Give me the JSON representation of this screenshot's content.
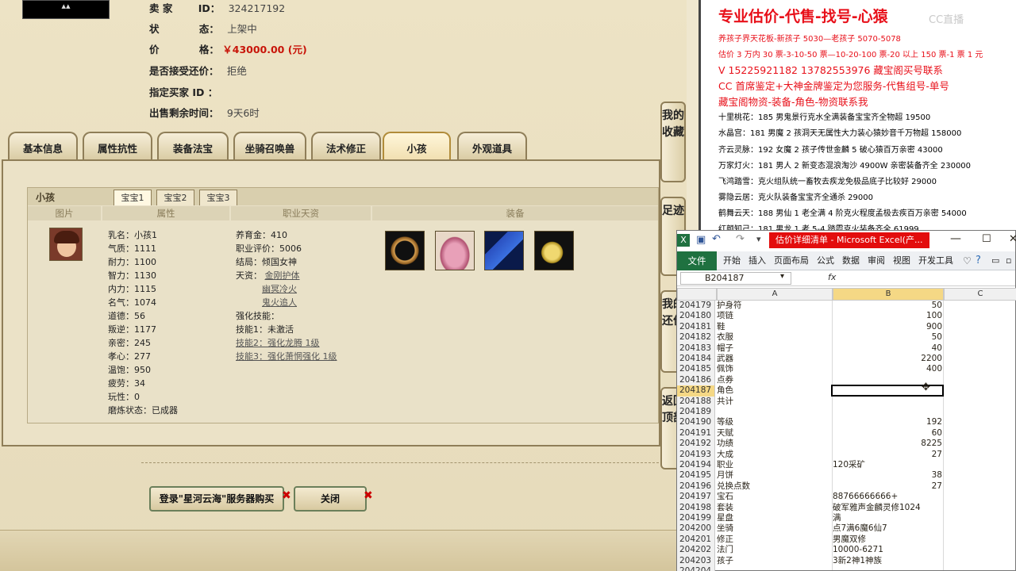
{
  "game": {
    "thumb_icon": "item-thumb",
    "seller_label": "卖 家",
    "seller_id_label": "ID：",
    "seller_id": "324217192",
    "status_label": "状",
    "status_label2": "态：",
    "status_value": "上架中",
    "price_label": "价",
    "price_label2": "格：",
    "price_value": "￥43000.00 (元)",
    "counter_offer_label": "是否接受还价：",
    "counter_offer_value": "拒绝",
    "buyer_label": "指定买家 ID ：",
    "time_label": "出售剩余时间：",
    "time_value": "9天6时",
    "tabs": [
      "基本信息",
      "属性抗性",
      "装备法宝",
      "坐骑召唤兽",
      "法术修正",
      "小孩",
      "外观道具"
    ],
    "panel_title": "小孩",
    "baby_tabs": [
      "宝宝1",
      "宝宝2",
      "宝宝3"
    ],
    "columns": [
      "图片",
      "属性",
      "职业天资",
      "装备"
    ],
    "attributes": [
      "乳名：小孩1",
      "气质：1111",
      "耐力：1100",
      "智力：1130",
      "内力：1115",
      "名气：1074",
      "道德：56",
      "叛逆：1177",
      "亲密：245",
      "孝心：277",
      "温饱：950",
      "疲劳：34",
      "玩性：0",
      "磨炼状态：已成器"
    ],
    "skills": {
      "foster": "养育金：410",
      "career": "职业评价：5006",
      "ending": "结局：倾国女神",
      "talent_label": "天资：",
      "talents": [
        "金刚护体",
        "幽冥冷火",
        "鬼火追人"
      ],
      "strengthen": "强化技能：",
      "skill1": "技能1：未激活",
      "skill2": "技能2：强化龙腾 1级",
      "skill3": "技能3：强化萧惘强化 1级"
    },
    "buttons": {
      "login_buy": "登录\"星河云海\"服务器购买",
      "close": "关闭"
    },
    "side_buttons": [
      "我的收藏",
      "足迹",
      "我的还价",
      "返回顶部"
    ]
  },
  "doc": {
    "title": "专业估价-代售-找号-心猿",
    "watermark": "CC直播",
    "lines": [
      {
        "text": "养孩子界天花板-新孩子 5030—老孩子 5070-5078",
        "style": "red"
      },
      {
        "text": "估价 3 万内 30 票-3-10-50 票—10-20-100 票-20 以上 150 票-1 票 1 元",
        "style": "red"
      },
      {
        "text": "V 15225921182     13782553976    藏宝阁买号联系",
        "style": "red big"
      },
      {
        "text": "CC 首席鉴定+大神金牌鉴定为您服务-代售组号-单号",
        "style": "red big"
      },
      {
        "text": "藏宝阁物资-装备-角色-物资联系我",
        "style": "red big"
      },
      {
        "text": "十里桃花：185 男鬼景行克水全满装备宝宝齐全物超 19500",
        "style": ""
      },
      {
        "text": "水晶宫：181 男魔 2 孩洞天无属性大力装心猿妙音千万物超 158000",
        "style": ""
      },
      {
        "text": "齐云灵脉：192 女魔 2 孩子传世金麟 5 破心猿百万亲密 43000",
        "style": ""
      },
      {
        "text": "万家灯火：181 男人 2 新变态混浪淘沙 4900W 亲密装备齐全 230000",
        "style": ""
      },
      {
        "text": "飞鸿踏雪：克火组队统一畜牧去疾龙免极品底子比较好 29000",
        "style": ""
      },
      {
        "text": "雾隐云居：克火队装备宝宝齐全通杀 29000",
        "style": ""
      },
      {
        "text": "鹤舞云天：188 男仙 1 老全满 4 阶克火程度孟极去疾百万亲密 54000",
        "style": ""
      },
      {
        "text": "红颜知己：181 男龙 1 老 5-4 踏霞克火装备齐全 61999",
        "style": ""
      }
    ]
  },
  "excel": {
    "window_title": "估价详细清单 - Microsoft Excel(产...",
    "file_tab": "文件",
    "ribbon_tabs": [
      "开始",
      "插入",
      "页面布局",
      "公式",
      "数据",
      "审阅",
      "视图",
      "开发工具"
    ],
    "name_box": "B204187",
    "fx": "fx",
    "col_headers": [
      "A",
      "B",
      "C"
    ],
    "rows": [
      {
        "n": "204179",
        "a": "护身符",
        "b": "50",
        "num": true
      },
      {
        "n": "204180",
        "a": "项链",
        "b": "100",
        "num": true
      },
      {
        "n": "204181",
        "a": "鞋",
        "b": "900",
        "num": true
      },
      {
        "n": "204182",
        "a": "衣服",
        "b": "50",
        "num": true
      },
      {
        "n": "204183",
        "a": "帽子",
        "b": "40",
        "num": true
      },
      {
        "n": "204184",
        "a": "武器",
        "b": "2200",
        "num": true
      },
      {
        "n": "204185",
        "a": "佩饰",
        "b": "400",
        "num": true
      },
      {
        "n": "204186",
        "a": "点券",
        "b": "",
        "num": true
      },
      {
        "n": "204187",
        "a": "角色",
        "b": "",
        "num": true
      },
      {
        "n": "204188",
        "a": "共计",
        "b": "",
        "num": true
      },
      {
        "n": "204189",
        "a": "",
        "b": "",
        "num": true
      },
      {
        "n": "204190",
        "a": "等级",
        "b": "192",
        "num": true
      },
      {
        "n": "204191",
        "a": "天赋",
        "b": "60",
        "num": true
      },
      {
        "n": "204192",
        "a": "功绩",
        "b": "8225",
        "num": true
      },
      {
        "n": "204193",
        "a": "大成",
        "b": "27",
        "num": true
      },
      {
        "n": "204194",
        "a": "职业",
        "b": "120采矿",
        "num": false
      },
      {
        "n": "204195",
        "a": "月饼",
        "b": "38",
        "num": true
      },
      {
        "n": "204196",
        "a": "兑换点数",
        "b": "27",
        "num": true
      },
      {
        "n": "204197",
        "a": "宝石",
        "b": "88766666666+",
        "num": false
      },
      {
        "n": "204198",
        "a": "套装",
        "b": "破军雅声金麟灵修1024",
        "num": false
      },
      {
        "n": "204199",
        "a": "星盘",
        "b": "满",
        "num": false
      },
      {
        "n": "204200",
        "a": "坐骑",
        "b": "点7满6魔6仙7",
        "num": false
      },
      {
        "n": "204201",
        "a": "修正",
        "b": "男魔双修",
        "num": false
      },
      {
        "n": "204202",
        "a": "法门",
        "b": "10000-6271",
        "num": false
      },
      {
        "n": "204203",
        "a": "孩子",
        "b": "3新2神1神族",
        "num": false
      },
      {
        "n": "204204",
        "a": "",
        "b": "",
        "num": false
      }
    ]
  }
}
